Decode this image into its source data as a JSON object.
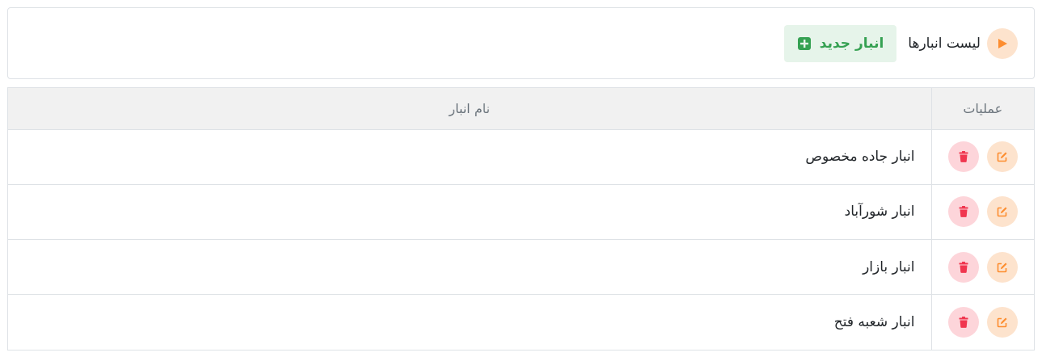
{
  "header": {
    "title": "لیست انبارها",
    "new_button_label": "انبار جدید"
  },
  "table": {
    "columns": {
      "operations": "عملیات",
      "name": "نام انبار"
    },
    "rows": [
      {
        "name": "انبار جاده مخصوص"
      },
      {
        "name": "انبار شورآباد"
      },
      {
        "name": "انبار بازار"
      },
      {
        "name": "انبار شعبه فتح"
      }
    ]
  },
  "icons": {
    "title_icon": "play-icon",
    "new_button_icon": "plus-square-icon",
    "edit_icon": "edit-icon",
    "delete_icon": "trash-icon"
  },
  "colors": {
    "accent_orange": "#fd8d2f",
    "success_green": "#35a152",
    "danger_red": "#f0364f"
  }
}
